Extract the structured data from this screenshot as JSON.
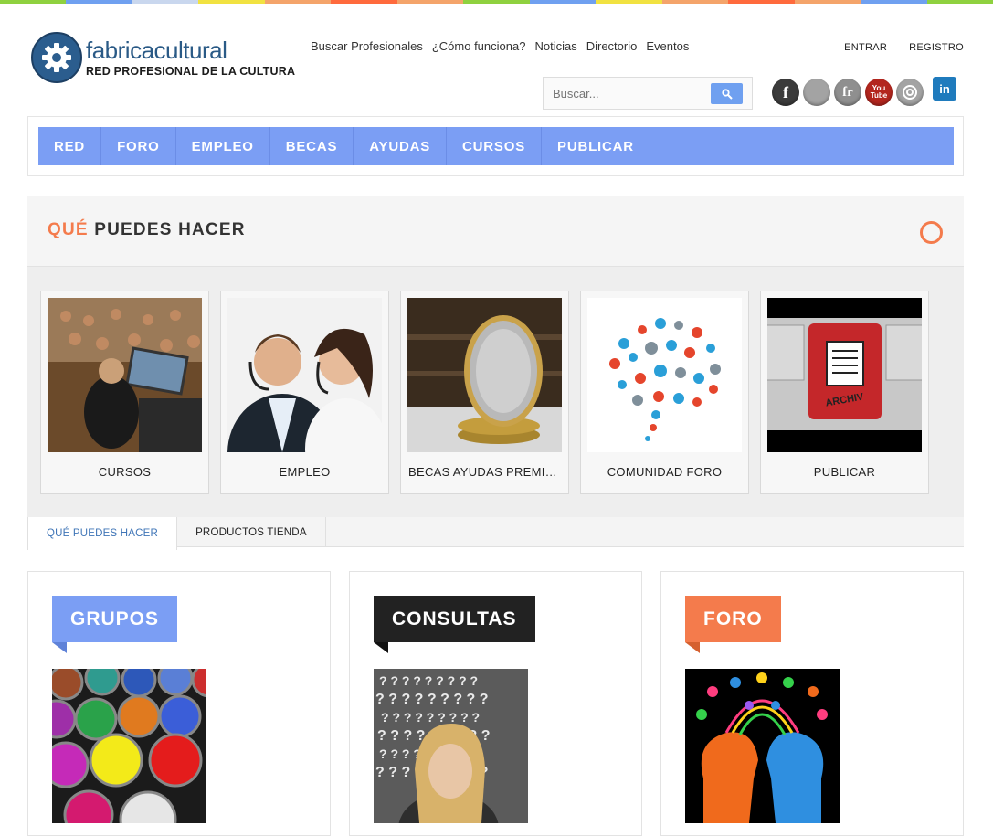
{
  "top_stripe_colors": [
    "#8fd13f",
    "#6fa0f0",
    "#c9d7ee",
    "#f1e241",
    "#f4a46b",
    "#ff6a3d",
    "#f4a46b",
    "#8fd13f",
    "#6fa0f0",
    "#f1e241",
    "#f4a46b",
    "#ff6a3d",
    "#f4a46b",
    "#6fa0f0",
    "#8fd13f"
  ],
  "brand": {
    "name": "fabricacultural",
    "tagline": "RED PROFESIONAL DE LA CULTURA"
  },
  "top_nav": [
    "Buscar Profesionales",
    "¿Cómo funciona?",
    "Noticias",
    "Directorio",
    "Eventos"
  ],
  "auth": {
    "login": "ENTRAR",
    "register": "REGISTRO"
  },
  "search": {
    "placeholder": "Buscar...",
    "value": ""
  },
  "social": [
    {
      "name": "facebook-icon",
      "glyph": "f",
      "color": "#3b3b3b"
    },
    {
      "name": "myspace-icon",
      "glyph": "",
      "color": "#9a9a9a"
    },
    {
      "name": "friendfeed-icon",
      "glyph": "fr",
      "color": "#8a8a8a"
    },
    {
      "name": "youtube-icon",
      "glyph": "You\nTube",
      "color": "#b3261e"
    },
    {
      "name": "target-icon",
      "glyph": "",
      "color": "#9a9a9a"
    },
    {
      "name": "linkedin-icon",
      "glyph": "in",
      "color": "#1f7bbd"
    }
  ],
  "main_nav": [
    "RED",
    "FORO",
    "EMPLEO",
    "BECAS",
    "AYUDAS",
    "CURSOS",
    "PUBLICAR"
  ],
  "panel": {
    "title_accent": "QUÉ",
    "title_rest": "PUEDES HACER"
  },
  "cards": [
    {
      "label": "CURSOS"
    },
    {
      "label": "EMPLEO"
    },
    {
      "label": "BECAS AYUDAS PREMIOS"
    },
    {
      "label": "COMUNIDAD FORO"
    },
    {
      "label": "PUBLICAR"
    }
  ],
  "tabs": [
    {
      "label": "QUÉ PUEDES HACER",
      "active": true
    },
    {
      "label": "PRODUCTOS TIENDA",
      "active": false
    }
  ],
  "features": [
    {
      "label": "GRUPOS",
      "color": "#7b9ef4"
    },
    {
      "label": "CONSULTAS",
      "color": "#222222"
    },
    {
      "label": "FORO",
      "color": "#f47b4c"
    }
  ]
}
